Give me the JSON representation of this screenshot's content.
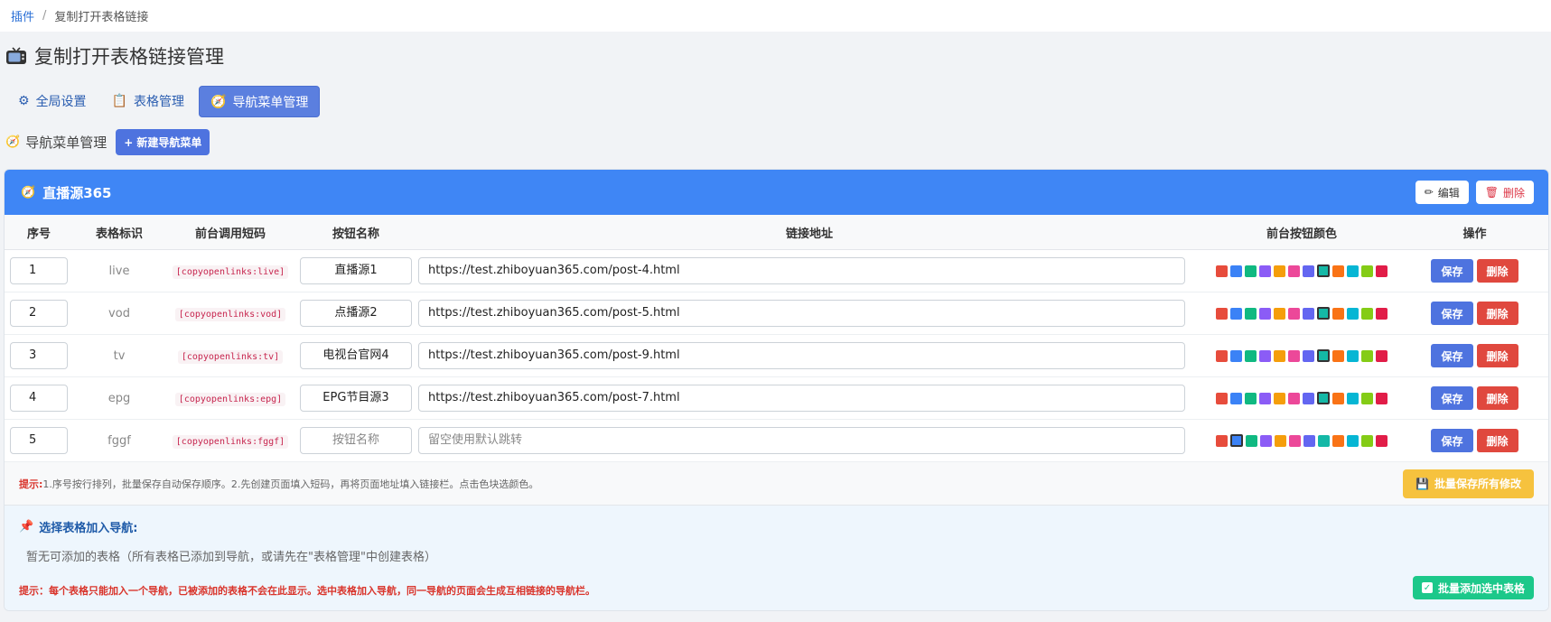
{
  "breadcrumb": {
    "parent": "插件",
    "separator": "/",
    "current": "复制打开表格链接"
  },
  "page_title": "复制打开表格链接管理",
  "tabs": [
    {
      "label": "全局设置",
      "icon": "gear-icon",
      "active": false
    },
    {
      "label": "表格管理",
      "icon": "clipboard-icon",
      "active": false
    },
    {
      "label": "导航菜单管理",
      "icon": "compass-icon",
      "active": true
    }
  ],
  "section": {
    "title": "导航菜单管理",
    "new_button": "+ 新建导航菜单"
  },
  "menu_card": {
    "title": "直播源365",
    "edit_label": "编辑",
    "delete_label": "删除",
    "columns": [
      "序号",
      "表格标识",
      "前台调用短码",
      "按钮名称",
      "链接地址",
      "前台按钮颜色",
      "操作"
    ],
    "palette": [
      "#e74c3c",
      "#3b82f6",
      "#10b981",
      "#8b5cf6",
      "#f59e0b",
      "#ec4899",
      "#6366f1",
      "#14b8a6",
      "#f97316",
      "#06b6d4",
      "#84cc16",
      "#e11d48"
    ],
    "rows": [
      {
        "seq": "1",
        "id": "live",
        "shortcode": "[copyopenlinks:live]",
        "button": "直播源1",
        "url": "https://test.zhiboyuan365.com/post-4.html",
        "selected_color": 7
      },
      {
        "seq": "2",
        "id": "vod",
        "shortcode": "[copyopenlinks:vod]",
        "button": "点播源2",
        "url": "https://test.zhiboyuan365.com/post-5.html",
        "selected_color": 7
      },
      {
        "seq": "3",
        "id": "tv",
        "shortcode": "[copyopenlinks:tv]",
        "button": "电视台官网4",
        "url": "https://test.zhiboyuan365.com/post-9.html",
        "selected_color": 7
      },
      {
        "seq": "4",
        "id": "epg",
        "shortcode": "[copyopenlinks:epg]",
        "button": "EPG节目源3",
        "url": "https://test.zhiboyuan365.com/post-7.html",
        "selected_color": 7
      },
      {
        "seq": "5",
        "id": "fggf",
        "shortcode": "[copyopenlinks:fggf]",
        "button": "",
        "button_placeholder": "按钮名称",
        "url": "",
        "url_placeholder": "留空使用默认跳转",
        "selected_color": 1
      }
    ],
    "save_label": "保存",
    "row_delete_label": "删除",
    "tip_prefix": "提示:",
    "tip_text": "1.序号按行排列，批量保存自动保存顺序。2.先创建页面填入短码，再将页面地址填入链接栏。点击色块选颜色。",
    "batch_save_label": "批量保存所有修改"
  },
  "select_area": {
    "title": "选择表格加入导航:",
    "empty_text": "暂无可添加的表格（所有表格已添加到导航，或请先在\"表格管理\"中创建表格）",
    "warning": "提示：每个表格只能加入一个导航，已被添加的表格不会在此显示。选中表格加入导航，同一导航的页面会生成互相链接的导航栏。",
    "batch_add_label": "批量添加选中表格"
  }
}
